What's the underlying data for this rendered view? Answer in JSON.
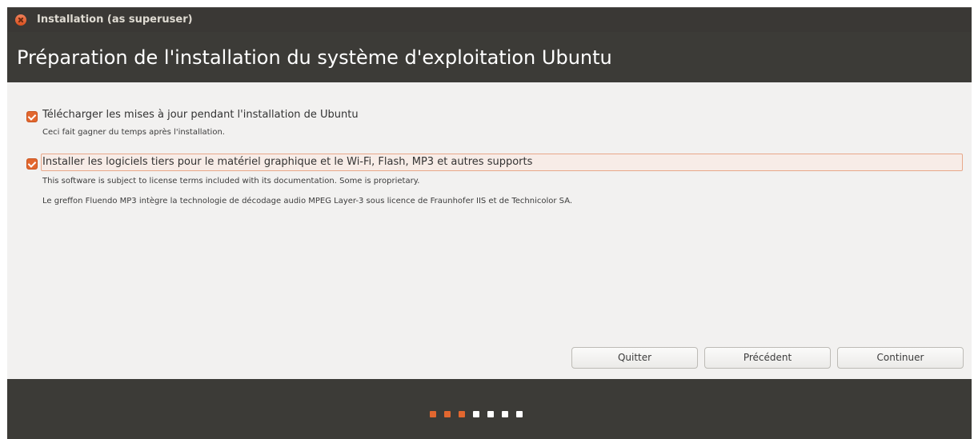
{
  "window": {
    "title": "Installation (as superuser)"
  },
  "header": {
    "title": "Préparation de l'installation du système d'exploitation Ubuntu"
  },
  "options": [
    {
      "label": "Télécharger les mises à jour pendant l'installation de Ubuntu",
      "checked": true,
      "descriptions": [
        "Ceci fait gagner du temps après l'installation."
      ]
    },
    {
      "label": "Installer les logiciels tiers pour le matériel graphique et le Wi-Fi, Flash, MP3 et autres supports",
      "checked": true,
      "descriptions": [
        "This software is subject to license terms included with its documentation. Some is proprietary.",
        "Le greffon Fluendo MP3 intègre la technologie de décodage audio MPEG Layer-3 sous licence de Fraunhofer IIS et de Technicolor SA."
      ]
    }
  ],
  "buttons": {
    "quit": "Quitter",
    "back": "Précédent",
    "continue": "Continuer"
  },
  "progress": {
    "total_steps": 7,
    "completed_steps": 3,
    "accent_color": "#e2672f",
    "inactive_color": "#ffffff"
  },
  "colors": {
    "header_bg": "#3c3b37",
    "body_bg": "#f2f1f0",
    "accent": "#e2672f"
  }
}
